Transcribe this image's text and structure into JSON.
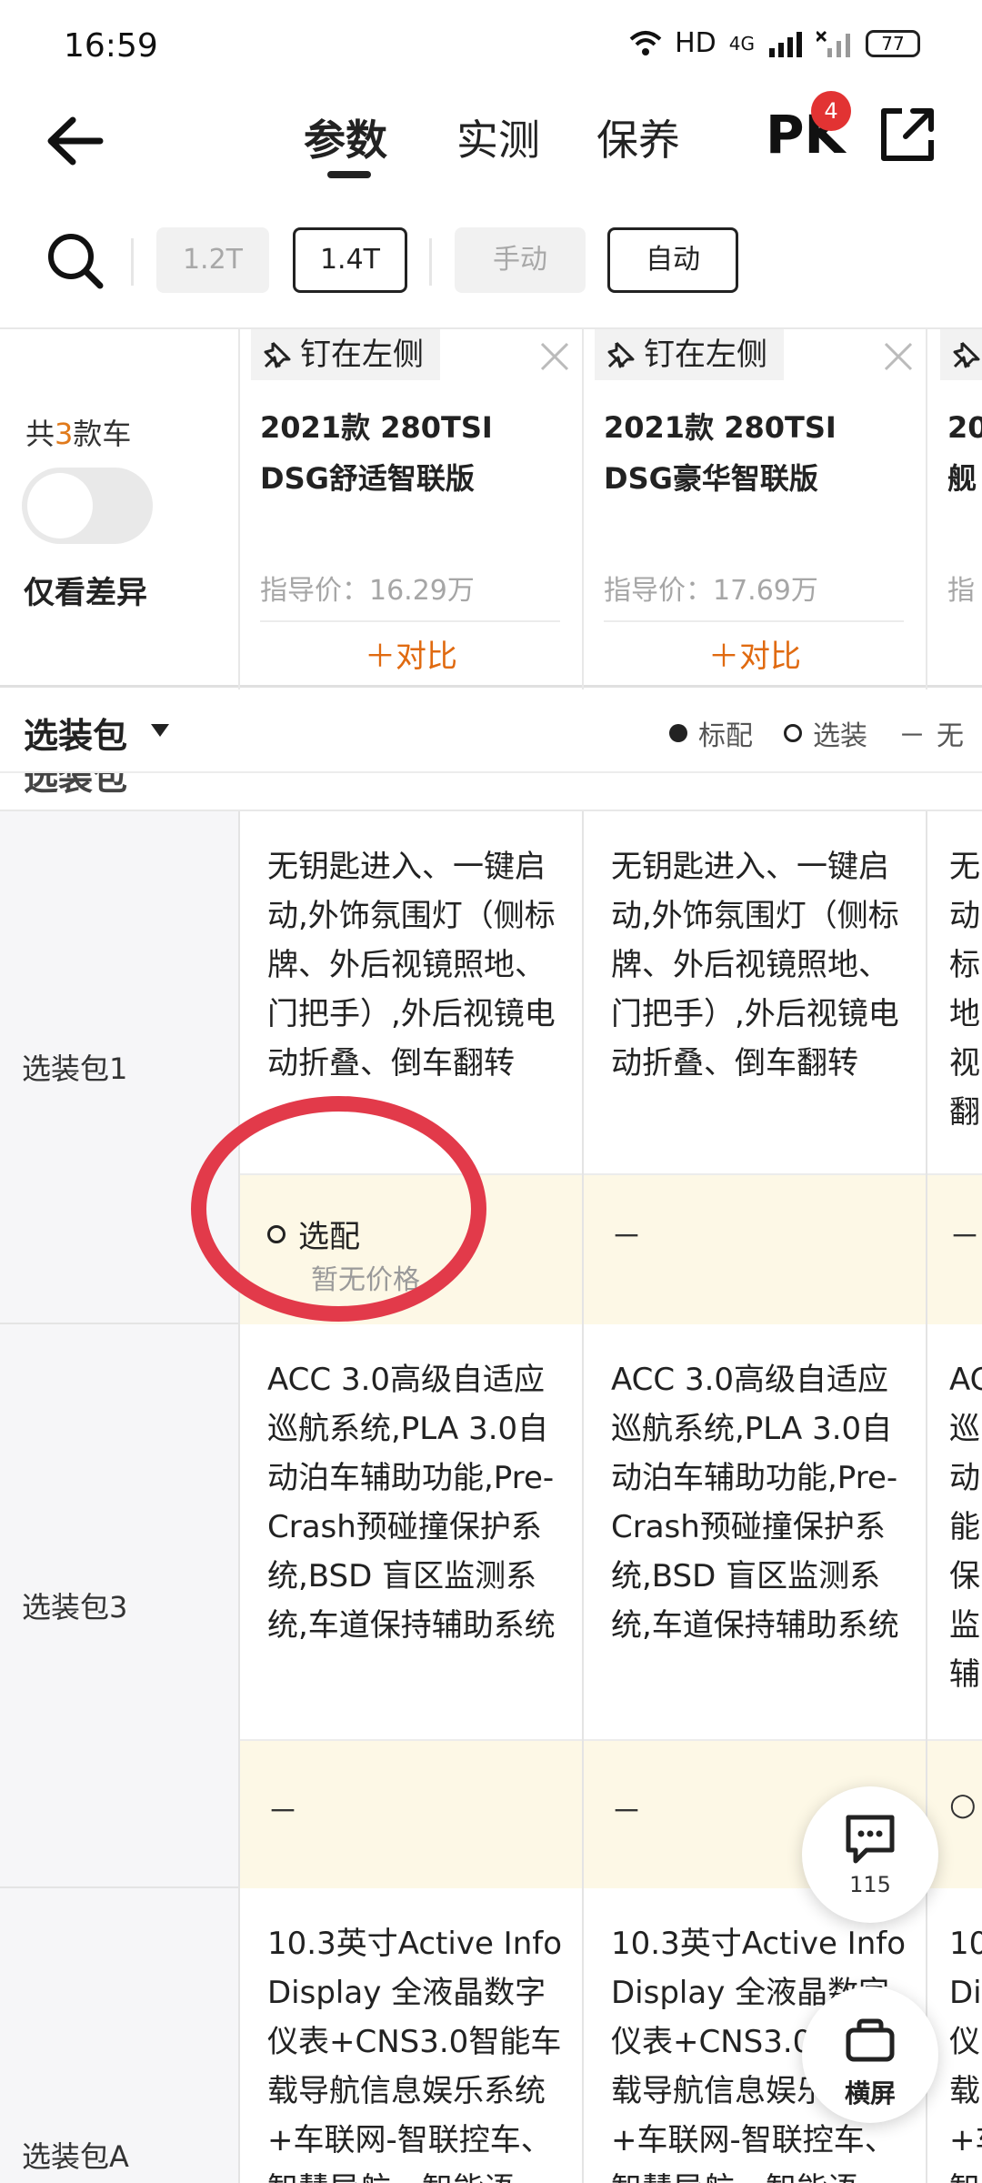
{
  "status_bar": {
    "time": "16:59",
    "network": "HD",
    "signal": "4G",
    "battery": "77"
  },
  "nav": {
    "tabs": [
      "参数",
      "实测",
      "保养"
    ],
    "active_tab": "参数",
    "pk_label": "PK",
    "pk_badge": "4"
  },
  "filters": {
    "chips": [
      {
        "label": "1.2T",
        "state": "disabled"
      },
      {
        "label": "1.4T",
        "state": "active"
      },
      {
        "label": "手动",
        "state": "disabled"
      },
      {
        "label": "自动",
        "state": "active"
      }
    ]
  },
  "header": {
    "count_prefix": "共",
    "count_num": "3",
    "count_suffix": "款车",
    "diff_label": "仅看差异",
    "diff_toggle_on": false
  },
  "cars": [
    {
      "pin": "钉在左侧",
      "name": "2021款 280TSI DSG舒适智联版",
      "price": "指导价：16.29万",
      "add": "＋对比"
    },
    {
      "pin": "钉在左侧",
      "name": "2021款 280TSI DSG豪华智联版",
      "price": "指导价：17.69万",
      "add": "＋对比"
    },
    {
      "pin": "",
      "name": "20\n舰",
      "price": "指",
      "add": ""
    }
  ],
  "section": {
    "title": "选装包",
    "legend": {
      "standard": "标配",
      "optional": "选装",
      "none": "无",
      "none_symbol": "－"
    }
  },
  "rows": [
    {
      "label": "选装包1",
      "cells": [
        {
          "desc": "无钥匙进入、一键启动,外饰氛围灯（侧标牌、外后视镜照地、门把手）,外后视镜电动折叠、倒车翻转",
          "status": "选配",
          "price_note": "暂无价格"
        },
        {
          "desc": "无钥匙进入、一键启动,外饰氛围灯（侧标牌、外后视镜照地、门把手）,外后视镜电动折叠、倒车翻转",
          "status": "－"
        },
        {
          "desc": "无\n动\n标\n地\n视\n翻",
          "status": "－"
        }
      ]
    },
    {
      "label": "选装包3",
      "cells": [
        {
          "desc": "ACC 3.0高级自适应巡航系统,PLA 3.0自动泊车辅助功能,Pre-Crash预碰撞保护系统,BSD 盲区监测系统,车道保持辅助系统",
          "status": "－"
        },
        {
          "desc": "ACC 3.0高级自适应巡航系统,PLA 3.0自动泊车辅助功能,Pre-Crash预碰撞保护系统,BSD 盲区监测系统,车道保持辅助系统",
          "status": "－"
        },
        {
          "desc": "AC\n巡\n动\n能\n保\n监\n辅",
          "status": "○"
        }
      ]
    },
    {
      "label": "选装包A",
      "cells": [
        {
          "desc": "10.3英寸Active Info Display 全液晶数字仪表+CNS3.0智能车载导航信息娱乐系统+车联网-智联控车、智慧导航、智能语"
        },
        {
          "desc": "10.3英寸Active Info Display 全液晶数字仪表+CNS3.0智能车载导航信息娱乐系统+车联网-智联控车、智慧导航、智能语"
        },
        {
          "desc": "10\nDi\n仪\n载\n+车\n智"
        }
      ]
    }
  ],
  "fab": {
    "comment_count": "115",
    "landscape_label": "横屏"
  },
  "colors": {
    "accent": "#e06a10",
    "badge": "#e23333",
    "highlight": "#e23a4a",
    "status_bg": "#fdf8e6"
  }
}
